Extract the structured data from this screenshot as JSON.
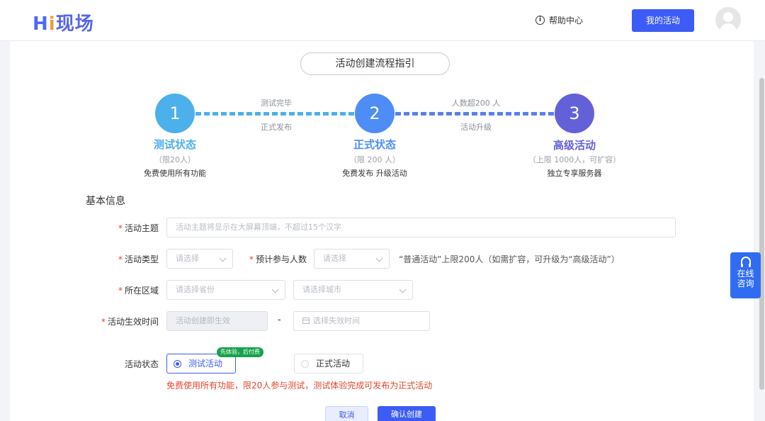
{
  "header": {
    "logo_hi_h": "H",
    "logo_hi_i": "i",
    "logo_cn": "现场",
    "help_label": "帮助中心",
    "my_activity_label": "我的活动"
  },
  "guide": {
    "title": "活动创建流程指引",
    "steps": [
      {
        "number": "1",
        "title": "测试状态",
        "limit": "（限20人）",
        "desc": "免费使用所有功能",
        "color": "#4cb0ea"
      },
      {
        "number": "2",
        "title": "正式状态",
        "limit": "（限 200 人）",
        "desc": "免费发布  升级活动",
        "color": "#4d8df5"
      },
      {
        "number": "3",
        "title": "高级活动",
        "limit": "（上限 1000人，可扩容）",
        "desc": "独立专享服务器",
        "color": "#6461d8"
      }
    ],
    "connectors": [
      {
        "top": "测试完毕",
        "bottom": "正式发布"
      },
      {
        "top": "人数超200 人",
        "bottom": "活动升级"
      }
    ]
  },
  "form": {
    "section_title": "基本信息",
    "required_mark": "*",
    "topic": {
      "label": "活动主题",
      "placeholder": "活动主题将显示在大屏幕顶端，不超过15个汉字"
    },
    "type": {
      "label": "活动类型",
      "placeholder": "请选择"
    },
    "participants": {
      "label": "预计参与人数",
      "placeholder": "请选择",
      "hint": "“普通活动”上限200人（如需扩容，可升级为“高级活动”）"
    },
    "region": {
      "label": "所在区域",
      "province_placeholder": "请选择省份",
      "city_placeholder": "请选择城市"
    },
    "effective_time": {
      "label": "活动生效时间",
      "start_value": "活动创建即生效",
      "separator": "-",
      "end_placeholder": "选择失效时间"
    },
    "status": {
      "label": "活动状态",
      "options": [
        {
          "label": "测试活动",
          "selected": true
        },
        {
          "label": "正式活动",
          "selected": false
        }
      ],
      "badge": "先体验，后付费",
      "warning": "免费使用所有功能，限20人参与测试，测试体验完成可发布为正式活动"
    }
  },
  "actions": {
    "cancel_label": "取消",
    "confirm_label": "确认创建"
  },
  "float_consult": {
    "line1": "在线",
    "line2": "咨询"
  },
  "colors": {
    "accent": "#3c5cf5",
    "warning": "#e2452e",
    "badge": "#15a34a"
  }
}
